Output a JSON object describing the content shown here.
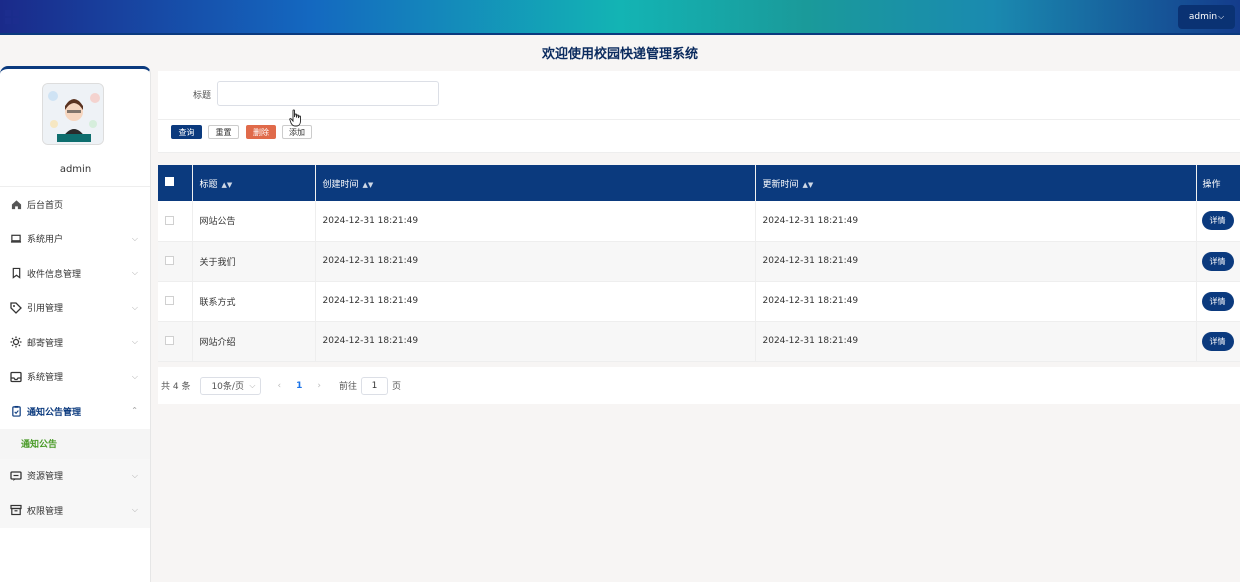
{
  "header": {
    "user_label": "admin"
  },
  "page_title": "欢迎使用校园快递管理系统",
  "sidebar": {
    "username": "admin",
    "items": [
      {
        "label": "后台首页",
        "icon": "home-icon"
      },
      {
        "label": "系统用户",
        "icon": "laptop-icon"
      },
      {
        "label": "收件信息管理",
        "icon": "bookmark-icon"
      },
      {
        "label": "引用管理",
        "icon": "tag-icon"
      },
      {
        "label": "邮寄管理",
        "icon": "sun-icon"
      },
      {
        "label": "系统管理",
        "icon": "inbox-icon"
      },
      {
        "label": "通知公告管理",
        "icon": "clipboard-icon"
      },
      {
        "label": "资源管理",
        "icon": "message-icon"
      },
      {
        "label": "权限管理",
        "icon": "archive-icon"
      }
    ],
    "submenu_active": "通知公告"
  },
  "search": {
    "title_label": "标题",
    "title_value": "",
    "buttons": {
      "query": "查询",
      "reset": "重置",
      "delete": "删除",
      "add": "添加"
    }
  },
  "table": {
    "columns": [
      "标题",
      "创建时间",
      "更新时间",
      "操作"
    ],
    "rows": [
      {
        "title": "网站公告",
        "created": "2024-12-31 18:21:49",
        "updated": "2024-12-31 18:21:49",
        "action": "详情"
      },
      {
        "title": "关于我们",
        "created": "2024-12-31 18:21:49",
        "updated": "2024-12-31 18:21:49",
        "action": "详情"
      },
      {
        "title": "联系方式",
        "created": "2024-12-31 18:21:49",
        "updated": "2024-12-31 18:21:49",
        "action": "详情"
      },
      {
        "title": "网站介绍",
        "created": "2024-12-31 18:21:49",
        "updated": "2024-12-31 18:21:49",
        "action": "详情"
      }
    ]
  },
  "pagination": {
    "total": "共 4 条",
    "page_size": "10条/页",
    "current_page": "1",
    "goto_label": "前往",
    "goto_value": "1",
    "goto_suffix": "页"
  },
  "colors": {
    "primary": "#0b3a7e",
    "danger": "#e06a4a",
    "active_sub": "#4a9b28"
  }
}
